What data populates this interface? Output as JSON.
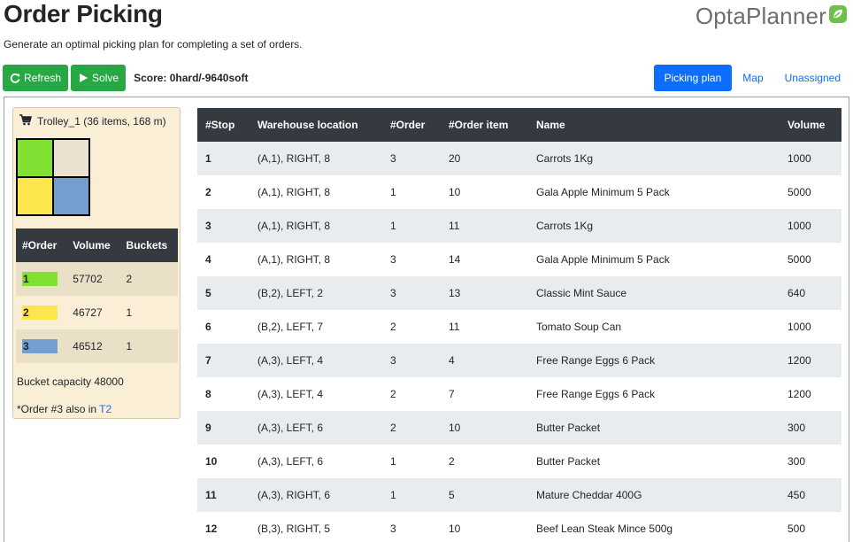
{
  "header": {
    "title": "Order Picking",
    "subtitle": "Generate an optimal picking plan for completing a set of orders.",
    "logo_text": "OptaPlanner",
    "logo_icon": "leaf-icon"
  },
  "toolbar": {
    "refresh_label": "Refresh",
    "refresh_icon": "refresh-icon",
    "solve_label": "Solve",
    "solve_icon": "play-icon",
    "score": "Score: 0hard/-9640soft"
  },
  "tabs": [
    {
      "label": "Picking plan",
      "active": true
    },
    {
      "label": "Map",
      "active": false
    },
    {
      "label": "Unassigned",
      "active": false
    }
  ],
  "trolley": {
    "icon": "cart-icon",
    "name": "Trolley_1",
    "summary": "(36 items, 168 m)",
    "bucket_fill": {
      "top_left": 1.0,
      "top_right": 0.0,
      "bottom_left": 1.0,
      "bottom_right": 1.0
    },
    "columns": [
      "#Order",
      "Volume",
      "Buckets"
    ],
    "orders": [
      {
        "order": "1",
        "color": "#82e032",
        "volume": "57702",
        "buckets": "2"
      },
      {
        "order": "2",
        "color": "#fde64b",
        "volume": "46727",
        "buckets": "1"
      },
      {
        "order": "3",
        "color": "#729fcf",
        "volume": "46512",
        "buckets": "1"
      }
    ],
    "capacity_text": "Bucket capacity 48000",
    "also_prefix": "*Order #3 also in ",
    "also_link": "T2"
  },
  "plan": {
    "columns": [
      "#Stop",
      "Warehouse location",
      "#Order",
      "#Order item",
      "Name",
      "Volume"
    ],
    "rows": [
      [
        "1",
        "(A,1), RIGHT, 8",
        "3",
        "20",
        "Carrots 1Kg",
        "1000"
      ],
      [
        "2",
        "(A,1), RIGHT, 8",
        "1",
        "10",
        "Gala Apple Minimum 5 Pack",
        "5000"
      ],
      [
        "3",
        "(A,1), RIGHT, 8",
        "1",
        "11",
        "Carrots 1Kg",
        "1000"
      ],
      [
        "4",
        "(A,1), RIGHT, 8",
        "3",
        "14",
        "Gala Apple Minimum 5 Pack",
        "5000"
      ],
      [
        "5",
        "(B,2), LEFT, 2",
        "3",
        "13",
        "Classic Mint Sauce",
        "640"
      ],
      [
        "6",
        "(B,2), LEFT, 7",
        "2",
        "11",
        "Tomato Soup Can",
        "1000"
      ],
      [
        "7",
        "(A,3), LEFT, 4",
        "3",
        "4",
        "Free Range Eggs 6 Pack",
        "1200"
      ],
      [
        "8",
        "(A,3), LEFT, 4",
        "2",
        "7",
        "Free Range Eggs 6 Pack",
        "1200"
      ],
      [
        "9",
        "(A,3), LEFT, 6",
        "2",
        "10",
        "Butter Packet",
        "300"
      ],
      [
        "10",
        "(A,3), LEFT, 6",
        "1",
        "2",
        "Butter Packet",
        "300"
      ],
      [
        "11",
        "(A,3), RIGHT, 6",
        "1",
        "5",
        "Mature Cheddar 400G",
        "450"
      ],
      [
        "12",
        "(B,3), RIGHT, 5",
        "3",
        "10",
        "Beef Lean Steak Mince 500g",
        "500"
      ]
    ]
  },
  "colors": {
    "primary": "#0d6efd",
    "success": "#28a745",
    "dark_header": "#343a40",
    "trolley_bg": "#faeed7",
    "logo_leaf": "#6cc04a"
  }
}
